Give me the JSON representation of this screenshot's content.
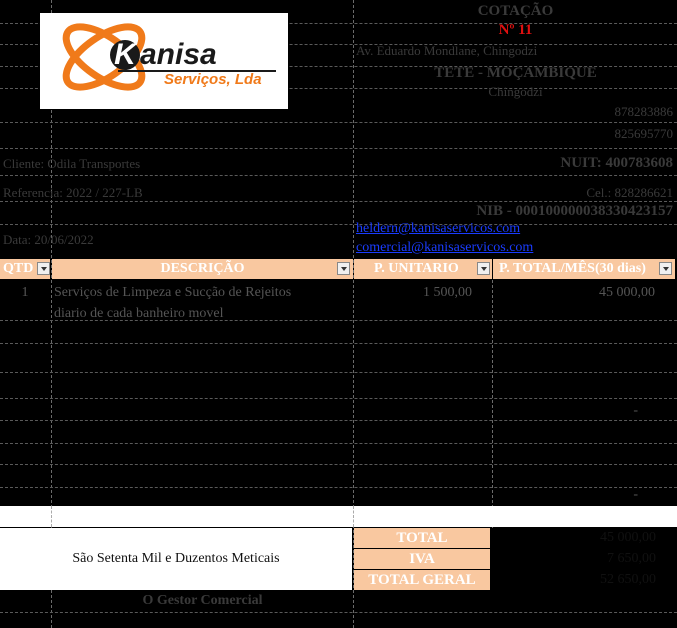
{
  "header": {
    "doc_type": "COTAÇÃO",
    "number": "Nº 11",
    "address": "Av. Eduardo Mondlane, Chingodzi",
    "city": "TETE - MOÇAMBIQUE",
    "subcity": "Chingodzi",
    "phone1": "878283886",
    "phone2": "825695770",
    "nuit": "NUIT: 400783608",
    "cell": "Cel.: 828286621",
    "nib": "NIB - 000100000038330423157",
    "email1": "heldern@kanisaservicos.com",
    "email2": "comercial@kanisaservicos.com"
  },
  "logo": {
    "brand_k": "K",
    "brand_rest": "anisa",
    "tagline": "Serviços, Lda",
    "color_orange": "#f07a1a",
    "color_dark": "#1a1a1a"
  },
  "client": {
    "name": "Cliente: Odila Transportes",
    "ref": "Referencia: 2022 / 227-LB",
    "date": "Data: 20/06/2022"
  },
  "table": {
    "headers": [
      "QTD",
      "DESCRIÇÃO",
      "P. UNITARIO",
      "P. TOTAL/MÊS(30 dias)"
    ],
    "rows": [
      {
        "qty": "1",
        "desc_line1": "Serviços de Limpeza e Sucção de Rejeitos",
        "desc_line2": "diario de cada banheiro movel",
        "unit": "1 500,00",
        "total": "45 000,00"
      }
    ],
    "dash1": "-",
    "dash2": "-"
  },
  "summary": {
    "amount_words": "São Setenta Mil e Duzentos Meticais",
    "total_label": "TOTAL",
    "total_value": "45 000,00",
    "iva_label": "IVA",
    "iva_value": "7 650,00",
    "grand_label": "TOTAL GERAL",
    "grand_value": "52 650,00"
  },
  "footer": {
    "signature": "O Gestor Comercial"
  },
  "colors": {
    "accent": "#f9c8a0",
    "header_red": "#e01010",
    "link_blue": "#1a3cff"
  }
}
